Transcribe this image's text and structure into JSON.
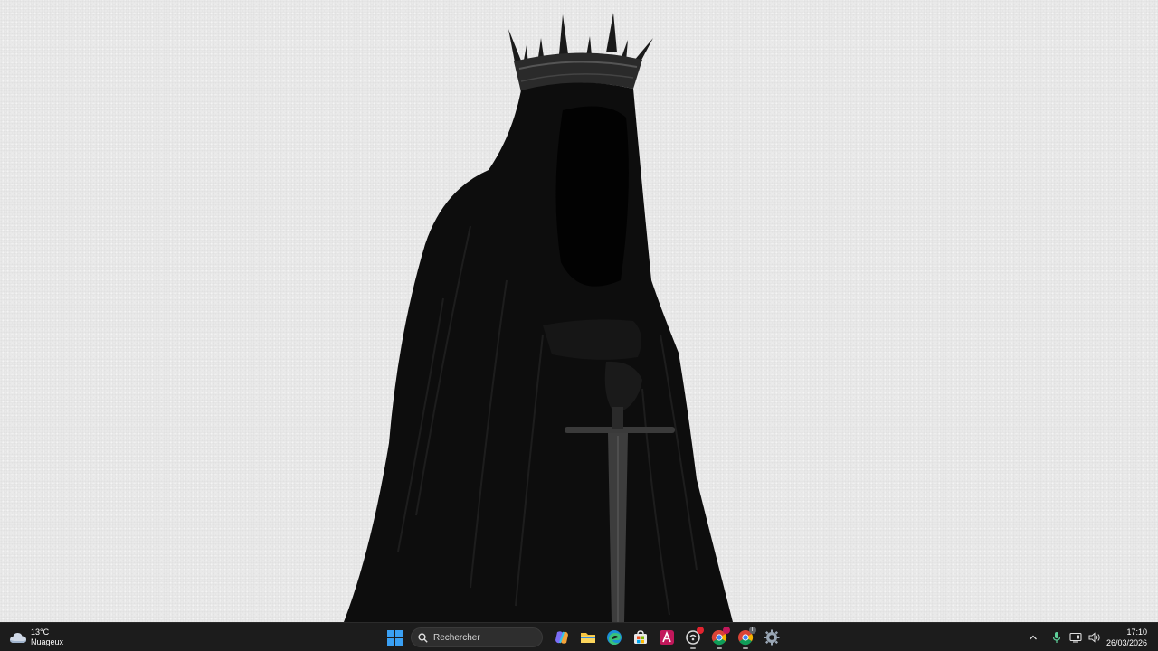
{
  "desktop": {
    "wallpaper": "hooded-crowned-figure-with-sword"
  },
  "taskbar": {
    "weather": {
      "temperature": "13°C",
      "condition": "Nuageux",
      "icon": "cloud-icon"
    },
    "search": {
      "label": "Rechercher"
    },
    "pinned_apps": [
      {
        "name": "start-button",
        "icon": "windows-logo-icon"
      },
      {
        "name": "copilot",
        "icon": "copilot-icon"
      },
      {
        "name": "file-explorer",
        "icon": "folder-icon"
      },
      {
        "name": "edge",
        "icon": "edge-icon"
      },
      {
        "name": "microsoft-store",
        "icon": "store-icon"
      },
      {
        "name": "affinity",
        "icon": "affinity-icon"
      },
      {
        "name": "app-with-notification",
        "icon": "opera-gx-icon"
      },
      {
        "name": "chrome-profile-1",
        "icon": "chrome-icon",
        "badge": "T"
      },
      {
        "name": "chrome-profile-2",
        "icon": "chrome-icon",
        "badge": "T"
      },
      {
        "name": "settings",
        "icon": "gear-icon"
      }
    ],
    "tray": {
      "icons": [
        "chevron-up-icon",
        "microphone-icon",
        "network-icon",
        "speaker-icon"
      ]
    },
    "clock": {
      "time": "17:10",
      "date": "26/03/2026"
    }
  },
  "colors": {
    "taskbar_bg": "#1c1c1c",
    "wallpaper_bg": "#e9e9e9",
    "accent_blue": "#3aa0f3"
  }
}
